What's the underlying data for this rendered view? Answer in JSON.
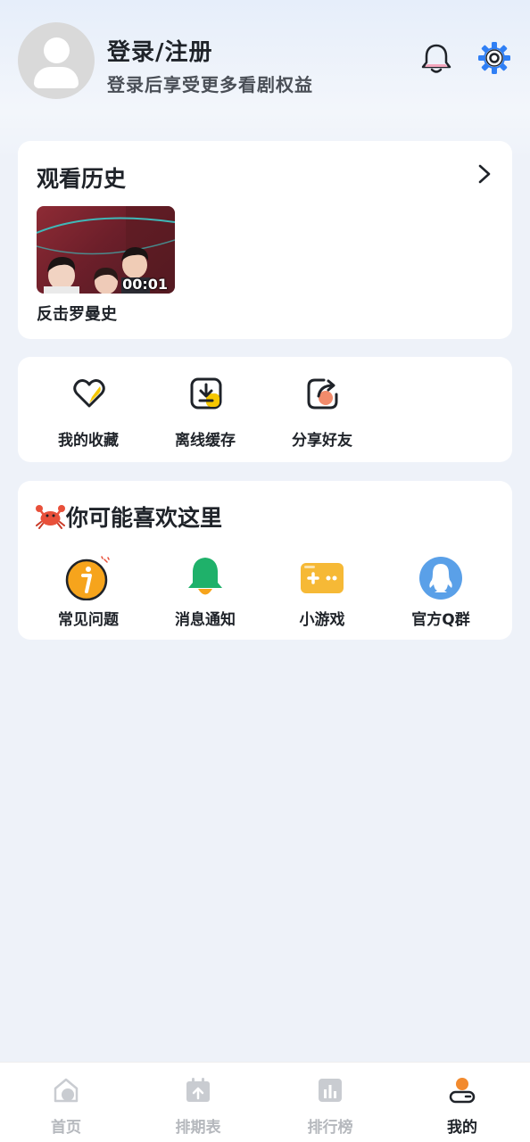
{
  "header": {
    "title": "登录/注册",
    "subtitle": "登录后享受更多看剧权益",
    "icons": {
      "bell": "bell-icon",
      "settings": "gear-icon"
    },
    "accent": "#2f7ff5"
  },
  "history": {
    "title": "观看历史",
    "items": [
      {
        "title": "反击罗曼史",
        "time": "00:01"
      }
    ]
  },
  "functions": [
    {
      "label": "我的收藏",
      "icon": "heart-icon"
    },
    {
      "label": "离线缓存",
      "icon": "download-icon"
    },
    {
      "label": "分享好友",
      "icon": "share-icon"
    }
  ],
  "recommend": {
    "title": "你可能喜欢这里",
    "items": [
      {
        "label": "常见问题",
        "icon": "info-icon"
      },
      {
        "label": "消息通知",
        "icon": "notification-bell-icon"
      },
      {
        "label": "小游戏",
        "icon": "gamepad-icon"
      },
      {
        "label": "官方Q群",
        "icon": "qq-icon"
      }
    ]
  },
  "tabbar": {
    "tabs": [
      {
        "label": "首页",
        "icon": "home-icon",
        "active": false
      },
      {
        "label": "排期表",
        "icon": "calendar-icon",
        "active": false
      },
      {
        "label": "排行榜",
        "icon": "ranking-icon",
        "active": false
      },
      {
        "label": "我的",
        "icon": "profile-icon",
        "active": true
      }
    ],
    "active_color": "#1f2329",
    "inactive_color": "#b5b8bd"
  }
}
